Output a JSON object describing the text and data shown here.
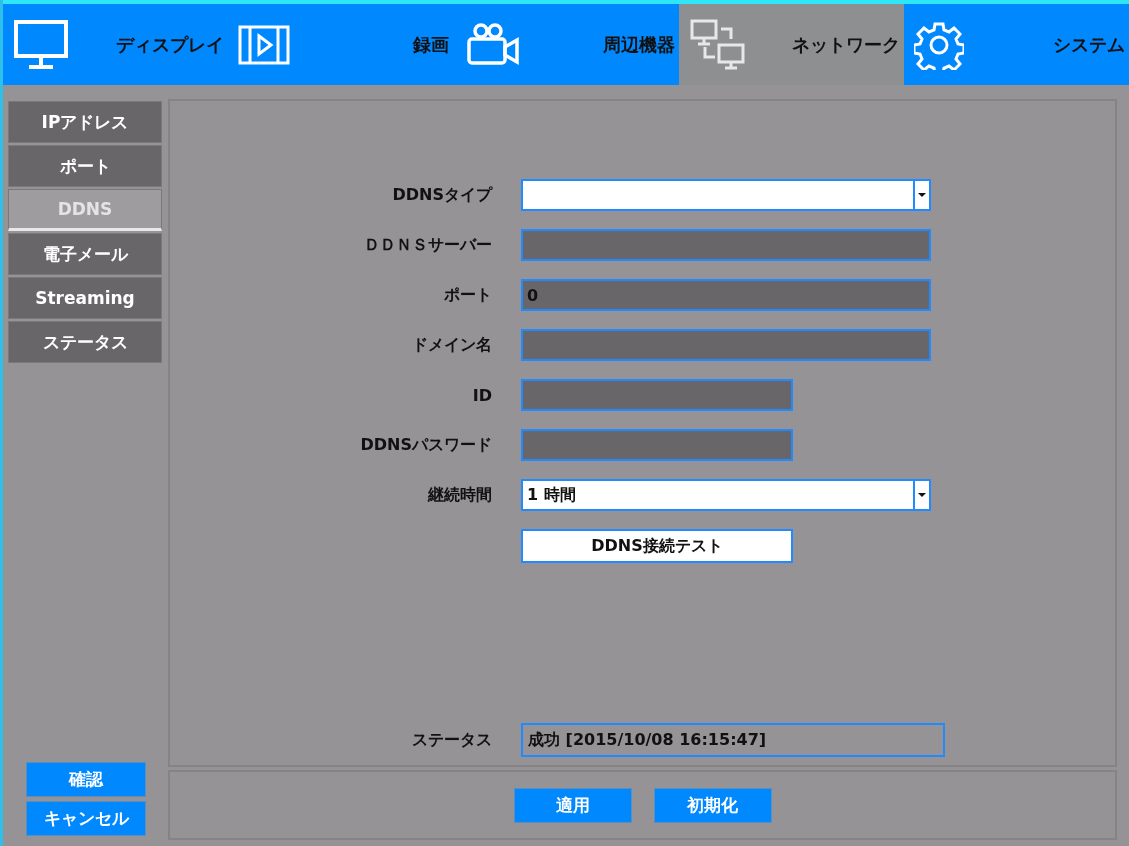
{
  "tabs": [
    {
      "label": "ディスプレイ",
      "kind": "monitor",
      "selected": false
    },
    {
      "label": "録画",
      "kind": "film",
      "selected": false
    },
    {
      "label": "周辺機器",
      "kind": "camera",
      "selected": false
    },
    {
      "label": "ネットワーク",
      "kind": "network",
      "selected": true
    },
    {
      "label": "システム",
      "kind": "gear",
      "selected": false
    }
  ],
  "sidebar": {
    "items": [
      {
        "label": "IPアドレス",
        "selected": false
      },
      {
        "label": "ポート",
        "selected": false
      },
      {
        "label": "DDNS",
        "selected": true
      },
      {
        "label": "電子メール",
        "selected": false
      },
      {
        "label": "Streaming",
        "selected": false
      },
      {
        "label": "ステータス",
        "selected": false
      }
    ],
    "buttons": [
      "確認",
      "キャンセル"
    ]
  },
  "form": {
    "fields": [
      {
        "label": "DDNSタイプ",
        "kind": "select"
      },
      {
        "label": "ＤＤＮＳサーバー",
        "kind": "text"
      },
      {
        "label": "ポート",
        "kind": "text",
        "value": "0"
      },
      {
        "label": "ドメイン名",
        "kind": "text"
      },
      {
        "label": "ID",
        "kind": "short_text"
      },
      {
        "label": "DDNSパスワード",
        "kind": "short_text"
      },
      {
        "label": "継続時間",
        "kind": "select",
        "value": "1 時間"
      },
      {
        "kind": "button",
        "value": "DDNS接続テスト"
      }
    ],
    "status": {
      "label": "ステータス",
      "value": "成功 [2015/10/08 16:15:47]"
    }
  },
  "footer": {
    "buttons": [
      "適用",
      "初期化"
    ]
  }
}
